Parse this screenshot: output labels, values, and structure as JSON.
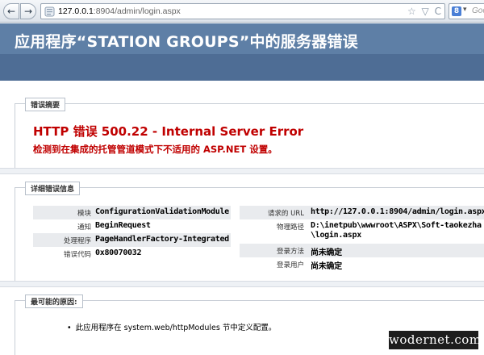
{
  "browser": {
    "back_glyph": "←",
    "forward_glyph": "→",
    "url_host": "127.0.0.1",
    "url_path": ":8904/admin/login.aspx",
    "star_glyph": "☆",
    "dropdown_glyph": "▽",
    "reload_glyph": "C",
    "search_engine_letter": "8",
    "search_caret": "▾",
    "search_placeholder": "Goo"
  },
  "header": {
    "title": "应用程序“STATION GROUPS”中的服务器错误"
  },
  "summary": {
    "legend": "错误摘要",
    "error_title": "HTTP 错误 500.22 - Internal Server Error",
    "error_desc": "检测到在集成的托管管道模式下不适用的 ASP.NET 设置。"
  },
  "details": {
    "legend": "详细错误信息",
    "left_rows": [
      {
        "key": "模块",
        "value": "ConfigurationValidationModule"
      },
      {
        "key": "通知",
        "value": "BeginRequest"
      },
      {
        "key": "处理程序",
        "value": "PageHandlerFactory-Integrated"
      },
      {
        "key": "错误代码",
        "value": "0x80070032"
      }
    ],
    "right_rows": [
      {
        "key": "请求的 URL",
        "value": "http://127.0.0.1:8904/admin/login.aspx"
      },
      {
        "key": "物理路径",
        "value": "D:\\inetpub\\wwwroot\\ASPX\\Soft-taokezha",
        "value2": "\\login.aspx"
      },
      {
        "key": "登录方法",
        "value": "尚未确定"
      },
      {
        "key": "登录用户",
        "value": "尚未确定"
      }
    ]
  },
  "causes": {
    "legend": "最可能的原因:",
    "items": [
      "此应用程序在 system.web/httpModules 节中定义配置。"
    ]
  },
  "watermark": "wodernet.com",
  "colors": {
    "header_blue": "#5e7fa6",
    "error_red": "#c00000"
  }
}
